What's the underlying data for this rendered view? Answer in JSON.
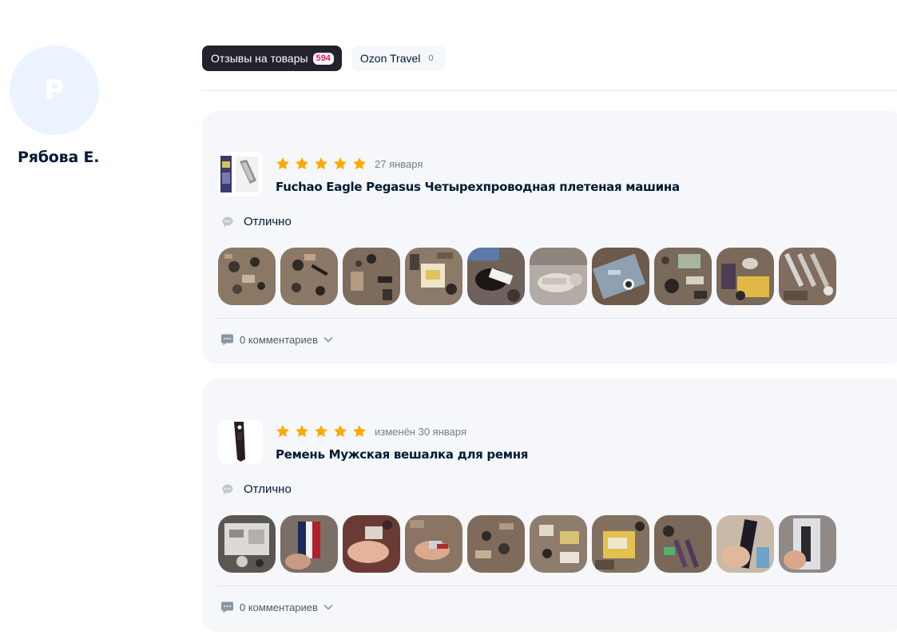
{
  "profile": {
    "avatar_letter": "Р",
    "name": "Рябова Е.",
    "avatar_color": "#eaf3ff"
  },
  "tabs": [
    {
      "label": "Отзывы на товары",
      "count": "594",
      "active": true
    },
    {
      "label": "Ozon Travel",
      "count": "0",
      "active": false
    }
  ],
  "colors": {
    "star": "#ffa800",
    "accent_count": "#f91155",
    "card_bg": "#f5f7fa"
  },
  "reviews": [
    {
      "rating": 5,
      "date": "27 января",
      "product_title": "Fuchao Eagle Pegasus Четырехпроводная плетеная машина",
      "text": "Отлично",
      "photo_count": 10,
      "comments_label": "0 комментариев"
    },
    {
      "rating": 5,
      "date": "изменён 30 января",
      "product_title": "Ремень Мужская вешалка для ремня",
      "text": "Отлично",
      "photo_count": 10,
      "comments_label": "0 комментариев"
    }
  ],
  "icons": {
    "comment": "speech-bubble-icon",
    "chevron": "chevron-down-icon",
    "star": "star-icon"
  }
}
